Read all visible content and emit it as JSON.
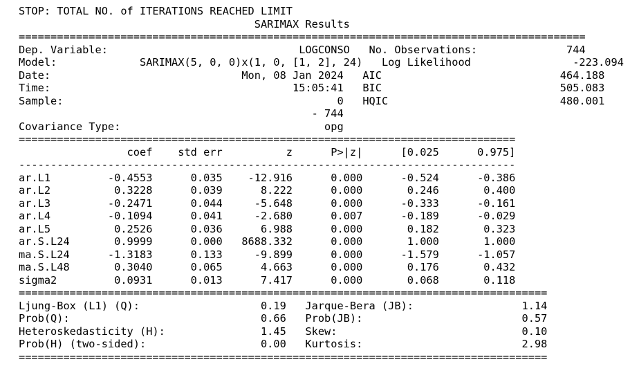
{
  "lines": [
    "STOP: TOTAL NO. of ITERATIONS REACHED LIMIT",
    "                                     SARIMAX Results                                     ",
    "=========================================================================================",
    "Dep. Variable:                              LOGCONSO   No. Observations:              744",
    "Model:             SARIMAX(5, 0, 0)x(1, 0, [1, 2], 24)   Log Likelihood                -223.094",
    "Date:                              Mon, 08 Jan 2024   AIC                            464.188",
    "Time:                                      15:05:41   BIC                            505.083",
    "Sample:                                           0   HQIC                           480.001",
    "                                              - 744                                         ",
    "Covariance Type:                                opg                                         ",
    "==============================================================================",
    "                 coef    std err          z      P>|z|      [0.025      0.975]",
    "------------------------------------------------------------------------------",
    "ar.L1         -0.4553      0.035    -12.916      0.000      -0.524      -0.386",
    "ar.L2          0.3228      0.039      8.222      0.000       0.246       0.400",
    "ar.L3         -0.2471      0.044     -5.648      0.000      -0.333      -0.161",
    "ar.L4         -0.1094      0.041     -2.680      0.007      -0.189      -0.029",
    "ar.L5          0.2526      0.036      6.988      0.000       0.182       0.323",
    "ar.S.L24       0.9999      0.000   8688.332      0.000       1.000       1.000",
    "ma.S.L24      -1.3183      0.133     -9.899      0.000      -1.579      -1.057",
    "ma.S.L48       0.3040      0.065      4.663      0.000       0.176       0.432",
    "sigma2         0.0931      0.013      7.417      0.000       0.068       0.118",
    "===================================================================================",
    "Ljung-Box (L1) (Q):                   0.19   Jarque-Bera (JB):                 1.14",
    "Prob(Q):                              0.66   Prob(JB):                         0.57",
    "Heteroskedasticity (H):               1.45   Skew:                             0.10",
    "Prob(H) (two-sided):                  0.00   Kurtosis:                         2.98",
    "==================================================================================="
  ]
}
